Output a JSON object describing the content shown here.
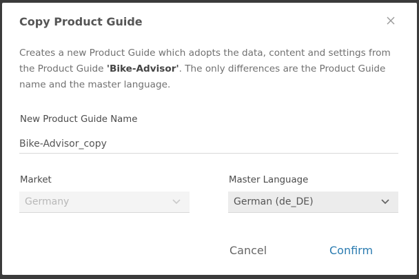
{
  "dialog": {
    "title": "Copy Product Guide",
    "description_before": "Creates a new Product Guide which adopts the data, content and settings from the Product Guide ",
    "description_guide_name": "'Bike-Advisor'",
    "description_after": ". The only differences are the Product Guide name and the master language.",
    "name_label": "New Product Guide Name",
    "name_value": "Bike-Advisor_copy",
    "market_label": "Market",
    "market_value": "Germany",
    "language_label": "Master Language",
    "language_value": "German (de_DE)",
    "cancel_label": "Cancel",
    "confirm_label": "Confirm"
  },
  "colors": {
    "accent": "#2a7bb0",
    "title": "#555555"
  },
  "icons": {
    "close": "close-icon",
    "dropdown": "chevron-down-icon"
  }
}
